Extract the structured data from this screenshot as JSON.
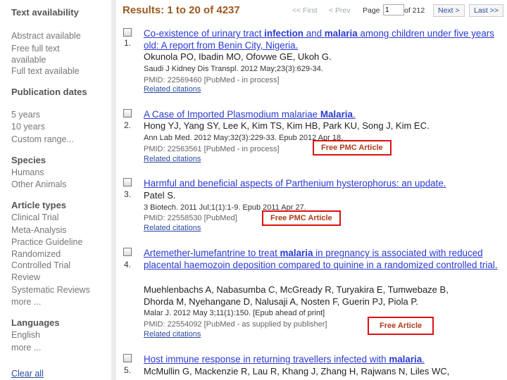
{
  "sidebar": {
    "text_availability": {
      "heading": "Text availability",
      "items": [
        "Abstract available",
        "Free full text available",
        "Full text available"
      ]
    },
    "publication_dates": {
      "heading": "Publication dates",
      "items": [
        "5 years",
        "10 years",
        "Custom range..."
      ]
    },
    "species": {
      "heading": "Species",
      "items": [
        "Humans",
        "Other Animals"
      ]
    },
    "article_types": {
      "heading": "Article types",
      "items": [
        "Clinical Trial",
        "Meta-Analysis",
        "Practice Guideline",
        "Randomized Controlled Trial",
        "Review",
        "Systematic Reviews",
        "more ..."
      ]
    },
    "languages": {
      "heading": "Languages",
      "items": [
        "English",
        "more ..."
      ]
    },
    "clear_all": "Clear all"
  },
  "header": {
    "results_label": "Results: 1 to 20 of 4237",
    "first": "<< First",
    "prev": "< Prev",
    "page_label": "Page",
    "page_value": "1",
    "of_label": "of 212",
    "next": "Next >",
    "last": "Last >>"
  },
  "results": [
    {
      "number": "1.",
      "title_parts": [
        "Co-existence of urinary tract ",
        "infection",
        " and ",
        "malaria",
        " among children under five years old: A report from Benin City, Nigeria."
      ],
      "authors": "Okunola PO, Ibadin MO, Ofovwe GE, Ukoh G.",
      "journal": "Saudi J Kidney Dis Transpl. 2012 May;23(3):629-34.",
      "pmid": "PMID: 22569460 [PubMed - in process]",
      "related": "Related citations",
      "free": ""
    },
    {
      "number": "2.",
      "title_parts": [
        "A Case of Imported Plasmodium malariae ",
        "Malaria",
        "."
      ],
      "authors": "Hong YJ, Yang SY, Lee K, Kim TS, Kim HB, Park KU, Song J, Kim EC.",
      "journal": "Ann Lab Med. 2012 May;32(3):229-33. Epub 2012 Apr 18.",
      "pmid": "PMID: 22563561 [PubMed - in process]",
      "related": "Related citations",
      "free": "Free PMC Article"
    },
    {
      "number": "3.",
      "title_parts": [
        "Harmful and beneficial aspects of Parthenium hysterophorus: an update."
      ],
      "authors": "Patel S.",
      "journal": "3 Biotech. 2011 Jul;1(1):1-9. Epub 2011 Apr 27.",
      "pmid": "PMID: 22558530 [PubMed]",
      "related": "Related citations",
      "free": "Free PMC Article"
    },
    {
      "number": "4.",
      "title_parts": [
        "Artemether-lumefantrine to treat ",
        "malaria",
        " in pregnancy is associated with reduced placental haemozoin deposition compared to quinine in a randomized controlled trial."
      ],
      "authors_lines": [
        "Muehlenbachs A, Nabasumba C, McGready R, Turyakira E, Tumwebaze B,",
        "Dhorda M, Nyehangane D, Nalusaji A, Nosten F, Guerin PJ, Piola P."
      ],
      "journal": "Malar J. 2012 May 3;11(1):150. [Epub ahead of print]",
      "pmid": "PMID: 22554092 [PubMed - as supplied by publisher]",
      "related": "Related citations",
      "free": "Free Article"
    },
    {
      "number": "5.",
      "title_parts": [
        "Host immune response in returning travellers infected with ",
        "malaria",
        "."
      ],
      "authors": "McMullin G, Mackenzie R, Lau R, Khang J, Zhang H, Rajwans N, Liles WC,"
    }
  ]
}
